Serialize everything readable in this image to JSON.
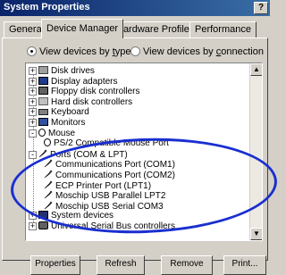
{
  "window": {
    "title": "System Properties",
    "help_label": "?"
  },
  "tabs": [
    {
      "label": "General",
      "active": false
    },
    {
      "label": "Device Manager",
      "active": true
    },
    {
      "label": "Hardware Profiles",
      "active": false
    },
    {
      "label": "Performance",
      "active": false
    }
  ],
  "view_options": {
    "by_type": {
      "label_pre": "View devices by ",
      "label_key": "t",
      "label_post": "ype",
      "selected": true
    },
    "by_connection": {
      "label_pre": "View devices by ",
      "label_key": "c",
      "label_post": "onnection",
      "selected": false
    }
  },
  "tree": [
    {
      "label": "Disk drives",
      "icon": "disk-drive-icon",
      "expander": "+",
      "level": 0
    },
    {
      "label": "Display adapters",
      "icon": "display-adapter-icon",
      "expander": "+",
      "level": 0
    },
    {
      "label": "Floppy disk controllers",
      "icon": "floppy-controller-icon",
      "expander": "+",
      "level": 0
    },
    {
      "label": "Hard disk controllers",
      "icon": "hard-disk-controller-icon",
      "expander": "+",
      "level": 0
    },
    {
      "label": "Keyboard",
      "icon": "keyboard-icon",
      "expander": "+",
      "level": 0
    },
    {
      "label": "Monitors",
      "icon": "monitor-icon",
      "expander": "+",
      "level": 0
    },
    {
      "label": "Mouse",
      "icon": "mouse-icon",
      "expander": "-",
      "level": 0
    },
    {
      "label": "PS/2 Compatible Mouse Port",
      "icon": "mouse-icon",
      "expander": "",
      "level": 1
    },
    {
      "label": "Ports (COM & LPT)",
      "icon": "port-icon",
      "expander": "-",
      "level": 0
    },
    {
      "label": "Communications Port (COM1)",
      "icon": "port-icon",
      "expander": "",
      "level": 1
    },
    {
      "label": "Communications Port (COM2)",
      "icon": "port-icon",
      "expander": "",
      "level": 1
    },
    {
      "label": "ECP Printer Port (LPT1)",
      "icon": "port-icon",
      "expander": "",
      "level": 1
    },
    {
      "label": "Moschip USB Parallel LPT2",
      "icon": "port-icon",
      "expander": "",
      "level": 1
    },
    {
      "label": "Moschip USB Serial COM3",
      "icon": "port-icon",
      "expander": "",
      "level": 1
    },
    {
      "label": "System devices",
      "icon": "system-device-icon",
      "expander": "+",
      "level": 0
    },
    {
      "label": "Universal Serial Bus controllers",
      "icon": "usb-controller-icon",
      "expander": "+",
      "level": 0
    }
  ],
  "scrollbar": {
    "up": "▲",
    "down": "▼"
  },
  "buttons": {
    "properties": "Properties",
    "refresh": "Refresh",
    "remove": "Remove",
    "print": "Print..."
  },
  "annotation_color": "#1a2fd0"
}
